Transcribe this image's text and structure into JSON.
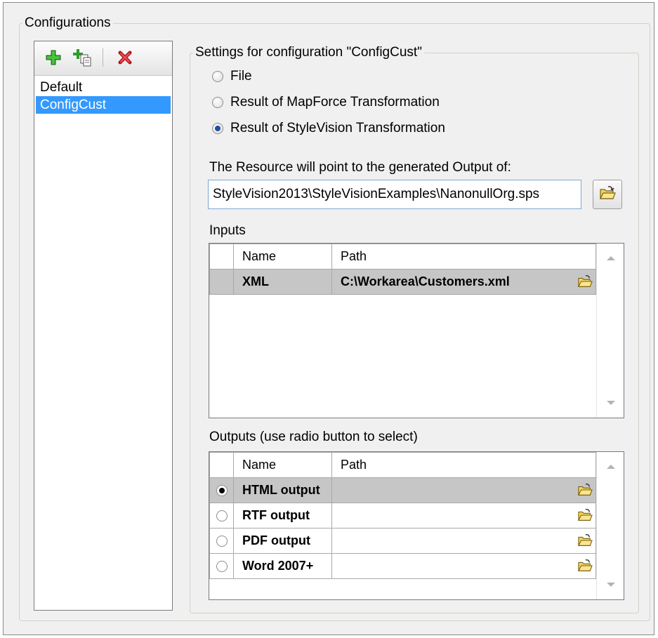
{
  "configurations": {
    "legend": "Configurations",
    "toolbar": {
      "icons": [
        "add-config-icon",
        "copy-config-icon",
        "delete-config-icon"
      ]
    },
    "items": [
      "Default",
      "ConfigCust"
    ],
    "selected": "ConfigCust"
  },
  "settings": {
    "legend": "Settings for configuration \"ConfigCust\"",
    "radios": [
      {
        "label": "File",
        "checked": false
      },
      {
        "label": "Result of MapForce Transformation",
        "checked": false
      },
      {
        "label": "Result of StyleVision Transformation",
        "checked": true
      }
    ],
    "resource_label": "The Resource will point to the generated Output of:",
    "resource_value": "StyleVision2013\\StyleVisionExamples\\NanonullOrg.sps"
  },
  "inputs": {
    "label": "Inputs",
    "columns": [
      "Name",
      "Path"
    ],
    "rows": [
      {
        "name": "XML",
        "path": "C:\\Workarea\\Customers.xml"
      }
    ]
  },
  "outputs": {
    "label": "Outputs (use radio button to select)",
    "columns": [
      "Name",
      "Path"
    ],
    "rows": [
      {
        "name": "HTML output",
        "path": "",
        "selected": true
      },
      {
        "name": "RTF output",
        "path": "",
        "selected": false
      },
      {
        "name": "PDF output",
        "path": "",
        "selected": false
      },
      {
        "name": "Word 2007+",
        "path": "",
        "selected": false
      }
    ]
  },
  "colors": {
    "selection": "#3399ff",
    "row_selected": "#c6c6c6",
    "background": "#f0f0f0"
  }
}
